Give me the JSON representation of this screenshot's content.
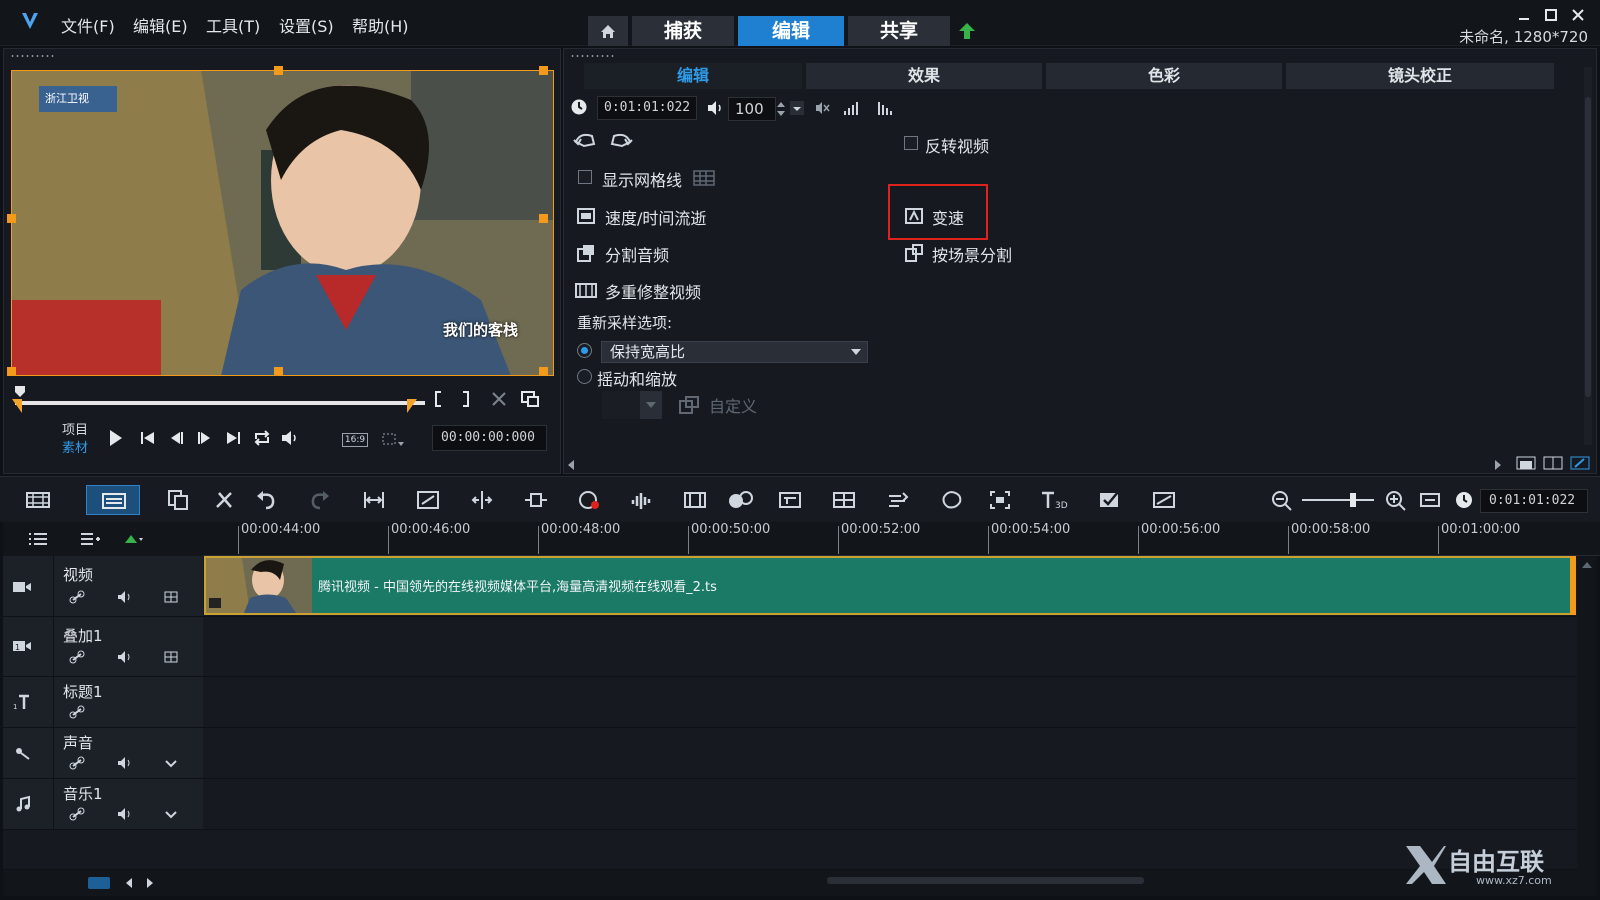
{
  "titlebar": {
    "menus": [
      "文件(F)",
      "编辑(E)",
      "工具(T)",
      "设置(S)",
      "帮助(H)"
    ],
    "nav_tabs": [
      "捕获",
      "编辑",
      "共享"
    ],
    "active_nav": "编辑",
    "project_info": "未命名, 1280*720"
  },
  "preview": {
    "channel_label": "浙江卫视",
    "badge_label": "我们的客栈",
    "timecode": "00:00:00:000",
    "mode_project": "项目",
    "mode_clip": "素材",
    "aspect": "16:9"
  },
  "options": {
    "tabs": [
      "编辑",
      "效果",
      "色彩",
      "镜头校正"
    ],
    "active_tab": "编辑",
    "timecode": "0:01:01:022",
    "volume": "100",
    "reverse_video": "反转视频",
    "show_grid": "显示网格线",
    "speed_time_lapse": "速度/时间流逝",
    "variable_speed": "变速",
    "split_audio": "分割音频",
    "split_by_scene": "按场景分割",
    "multi_trim": "多重修整视频",
    "resample_label": "重新采样选项:",
    "resample_value": "保持宽高比",
    "pan_zoom": "摇动和缩放",
    "custom": "自定义"
  },
  "timeline": {
    "timecode": "0:01:01:022",
    "ruler_ticks": [
      "00:00:44:00",
      "00:00:46:00",
      "00:00:48:00",
      "00:00:50:00",
      "00:00:52:00",
      "00:00:54:00",
      "00:00:56:00",
      "00:00:58:00",
      "00:01:00:00"
    ],
    "tracks": [
      {
        "name": "视频"
      },
      {
        "name": "叠加1"
      },
      {
        "name": "标题1"
      },
      {
        "name": "声音"
      },
      {
        "name": "音乐1"
      }
    ],
    "clip_title": "腾讯视频 - 中国领先的在线视频媒体平台,海量高清视频在线观看_2.ts"
  },
  "watermark": {
    "brand": "自由互联",
    "url": "www.xz7.com"
  },
  "colors": {
    "accent": "#1f7fd0",
    "clip": "#1a7a66",
    "highlight": "#e0221c",
    "handle": "#f39a1a"
  }
}
